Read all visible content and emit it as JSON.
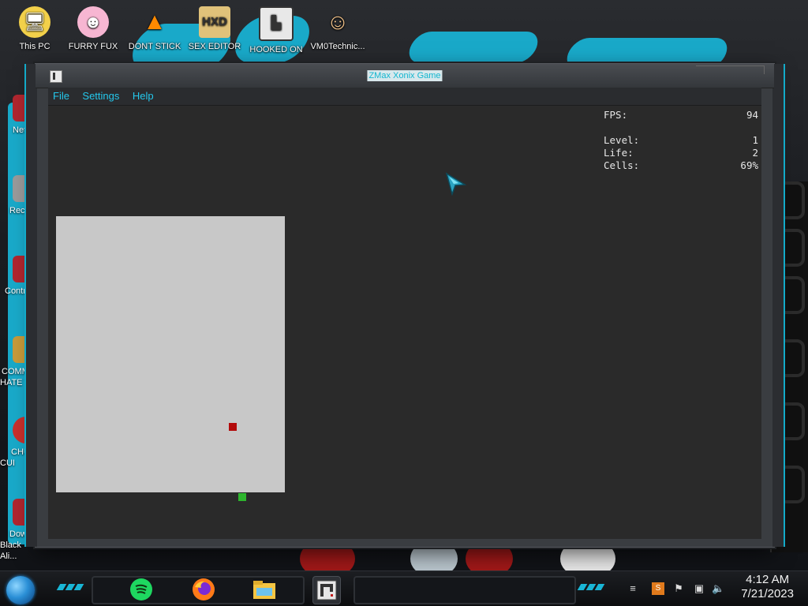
{
  "desktop": {
    "icons": [
      {
        "label": "This PC"
      },
      {
        "label": "FURRY FUX"
      },
      {
        "label": "DONT STICK"
      },
      {
        "label": "SEX EDITOR"
      },
      {
        "label": "HOOKED ON"
      },
      {
        "label": "VM0Technic..."
      }
    ],
    "left_icons": [
      {
        "label": "Netw"
      },
      {
        "label": "Recycl"
      },
      {
        "label": "Control"
      },
      {
        "label": "COMMU HATE TH"
      },
      {
        "label": "CHUZ CUI"
      },
      {
        "label": "Downl Black Ali..."
      }
    ]
  },
  "window": {
    "title": "ZMax Xonix Game",
    "menu": [
      "File",
      "Settings",
      "Help"
    ]
  },
  "stats": {
    "fps_label": "FPS:",
    "fps_value": "94",
    "level_label": "Level:",
    "level_value": "1",
    "life_label": "Life:",
    "life_value": "2",
    "cells_label": "Cells:",
    "cells_value": "69%"
  },
  "taskbar": {
    "time": "4:12 AM",
    "date": "7/21/2023"
  },
  "colors": {
    "accent": "#19a9c9",
    "menu_text": "#24c8ec",
    "board": "#c8c8c8",
    "enemy": "#b30a0a",
    "player": "#2db52d",
    "client_bg": "#2a2a2a"
  },
  "icons": [
    "start-orb-icon",
    "spotify-icon",
    "firefox-icon",
    "file-explorer-icon",
    "xonix-app-icon",
    "speaker-icon",
    "network-icon"
  ]
}
